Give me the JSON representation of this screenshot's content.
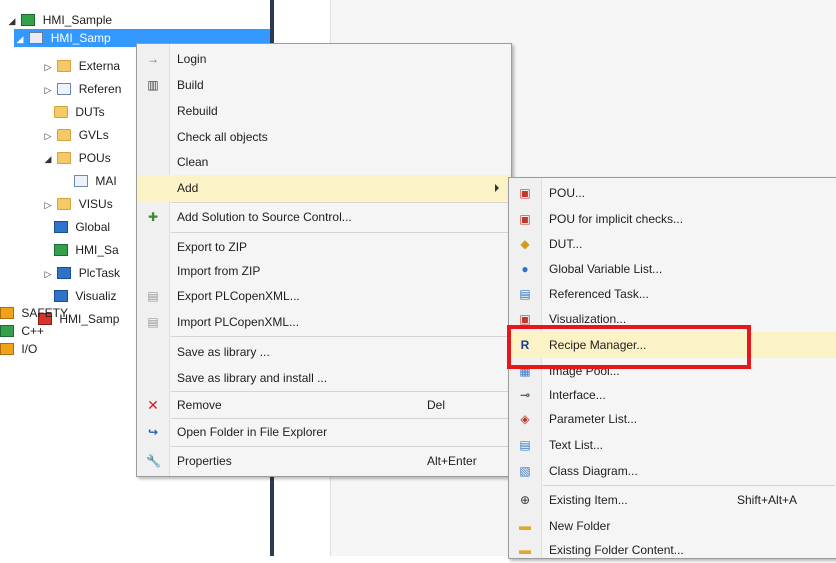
{
  "tree": {
    "root": "HMI_Sample",
    "app": "HMI_Samp",
    "items": [
      "Externa",
      "Referen",
      "DUTs",
      "GVLs",
      "POUs",
      "MAI",
      "VISUs",
      "Global",
      "HMI_Sa",
      "PlcTask",
      "Visualiz"
    ],
    "project": "HMI_Samp",
    "bottom": [
      "SAFETY",
      "C++",
      "I/O"
    ]
  },
  "context_menu": {
    "items": [
      {
        "label": "Login",
        "icon": "login-arrow-icon"
      },
      {
        "label": "Build",
        "icon": "build-icon"
      },
      {
        "label": "Rebuild"
      },
      {
        "label": "Check all objects"
      },
      {
        "label": "Clean"
      },
      {
        "label": "Add",
        "has_submenu": true
      },
      {
        "label": "Add Solution to Source Control...",
        "icon": "source-control-icon"
      },
      {
        "label": "Export to ZIP"
      },
      {
        "label": "Import from ZIP"
      },
      {
        "label": "Export PLCopenXML...",
        "icon": "xml-export-icon"
      },
      {
        "label": "Import PLCopenXML...",
        "icon": "xml-import-icon"
      },
      {
        "label": "Save as library ..."
      },
      {
        "label": "Save as library and install ..."
      },
      {
        "label": "Remove",
        "shortcut": "Del",
        "icon": "remove-x-icon"
      },
      {
        "label": "Open Folder in File Explorer",
        "icon": "open-folder-arrow-icon"
      },
      {
        "label": "Properties",
        "shortcut": "Alt+Enter",
        "icon": "wrench-icon"
      }
    ]
  },
  "submenu": {
    "items": [
      {
        "label": "POU...",
        "icon": "pou-icon"
      },
      {
        "label": "POU for implicit checks...",
        "icon": "pou-checks-icon"
      },
      {
        "label": "DUT...",
        "icon": "dut-icon"
      },
      {
        "label": "Global Variable List...",
        "icon": "globe-icon"
      },
      {
        "label": "Referenced Task...",
        "icon": "task-icon"
      },
      {
        "label": "Visualization...",
        "icon": "visualization-icon"
      },
      {
        "label": "Recipe Manager...",
        "icon": "recipe-icon"
      },
      {
        "label": "Image Pool...",
        "icon": "image-pool-icon"
      },
      {
        "label": "Interface...",
        "icon": "interface-icon"
      },
      {
        "label": "Parameter List...",
        "icon": "parameter-icon"
      },
      {
        "label": "Text List...",
        "icon": "text-list-icon"
      },
      {
        "label": "Class Diagram...",
        "icon": "class-diagram-icon"
      },
      {
        "label": "Existing Item...",
        "shortcut": "Shift+Alt+A",
        "icon": "existing-item-icon"
      },
      {
        "label": "New Folder",
        "icon": "new-folder-icon"
      },
      {
        "label": "Existing Folder Content...",
        "icon": "folder-content-icon"
      }
    ]
  },
  "colors": {
    "selection": "#3399ff",
    "menu_hover": "#fbf3c6",
    "highlight_border": "#e8151b"
  }
}
